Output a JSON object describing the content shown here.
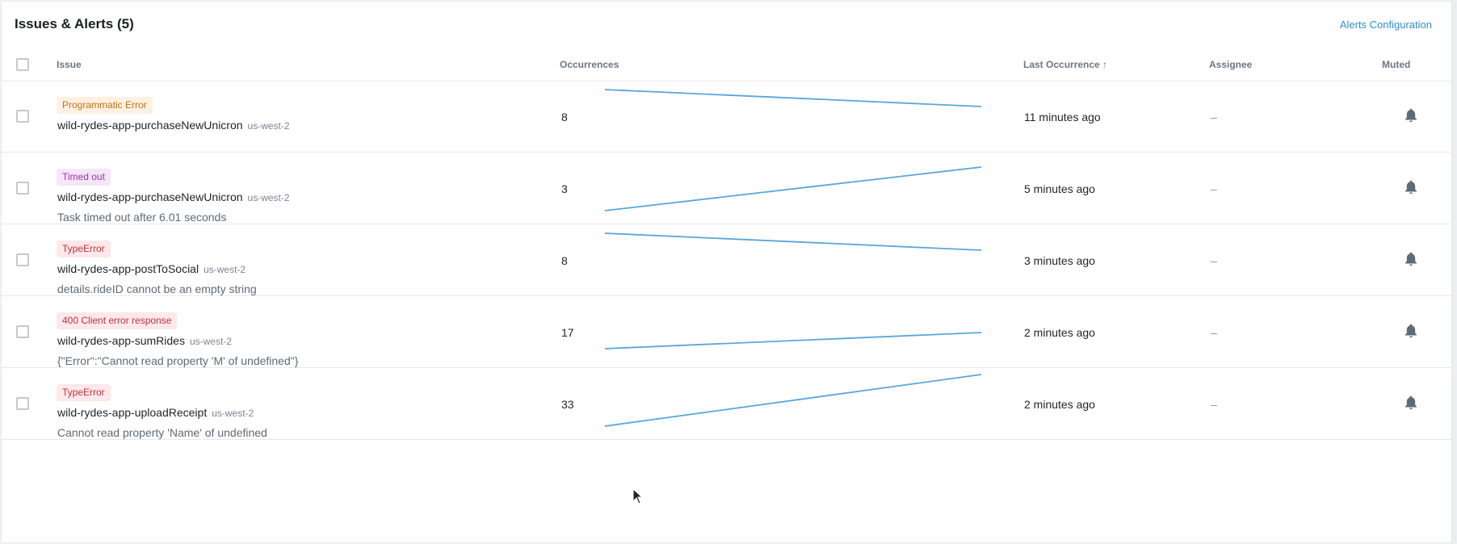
{
  "header": {
    "title": "Issues & Alerts",
    "count": "(5)",
    "config_link": "Alerts Configuration"
  },
  "columns": {
    "issue": "Issue",
    "occurrences": "Occurrences",
    "last_occurrence": "Last Occurrence ↑",
    "assignee": "Assignee",
    "muted": "Muted"
  },
  "colors": {
    "sparkline": "#5aa7d8",
    "link": "#2f8fd0",
    "bell": "#5d6b78"
  },
  "rows": [
    {
      "badge": "Programmatic Error",
      "badge_color": "orange",
      "function": "wild-rydes-app-purchaseNewUnicron",
      "region": "us-west-2",
      "message": "",
      "occurrences": "8",
      "trend": [
        8,
        6
      ],
      "last_occurrence": "11 minutes ago",
      "assignee": "–",
      "muted_icon": "bell-icon"
    },
    {
      "badge": "Timed out",
      "badge_color": "purple",
      "function": "wild-rydes-app-purchaseNewUnicron",
      "region": "us-west-2",
      "message": "Task timed out after 6.01 seconds",
      "occurrences": "3",
      "trend": [
        1,
        5
      ],
      "last_occurrence": "5 minutes ago",
      "assignee": "–",
      "muted_icon": "bell-icon"
    },
    {
      "badge": "TypeError",
      "badge_color": "red",
      "function": "wild-rydes-app-postToSocial",
      "region": "us-west-2",
      "message": "details.rideID cannot be an empty string",
      "occurrences": "8",
      "trend": [
        8,
        6
      ],
      "last_occurrence": "3 minutes ago",
      "assignee": "–",
      "muted_icon": "bell-icon"
    },
    {
      "badge": "400 Client error response",
      "badge_color": "red",
      "function": "wild-rydes-app-sumRides",
      "region": "us-west-2",
      "message": "{\"Error\":\"Cannot read property 'M' of undefined\"}",
      "occurrences": "17",
      "trend": [
        6,
        8
      ],
      "last_occurrence": "2 minutes ago",
      "assignee": "–",
      "muted_icon": "bell-icon"
    },
    {
      "badge": "TypeError",
      "badge_color": "red",
      "function": "wild-rydes-app-uploadReceipt",
      "region": "us-west-2",
      "message": "Cannot read property 'Name' of undefined",
      "occurrences": "33",
      "trend": [
        12,
        16
      ],
      "last_occurrence": "2 minutes ago",
      "assignee": "–",
      "muted_icon": "bell-icon"
    }
  ]
}
